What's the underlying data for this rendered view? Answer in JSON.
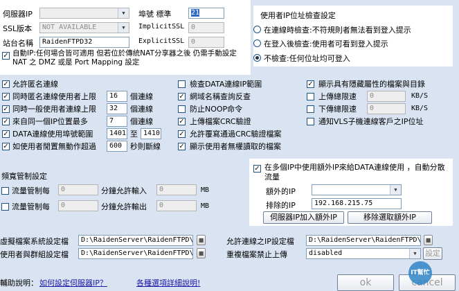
{
  "server": {
    "ip_label": "伺服器IP",
    "ip_value": "",
    "ssl_label": "SSL版本",
    "ssl_value": "NOT AVAILABLE",
    "site_label": "站台名稱",
    "site_value": "RaidenFTPD32",
    "port_label": "埠號 標準",
    "port_value": "21",
    "implicit_label": "ImplicitSSL",
    "implicit_value": "0",
    "explicit_label": "ExplicitSSL",
    "explicit_value": "0",
    "auto_ip_label": "自動IP:任何場合皆可適用 但若位於傳統NAT分享器之後 仍需手動設定 NAT 之 DMZ 或是 Port Mapping 設定",
    "auto_ip_checked": true
  },
  "ip_check": {
    "title": "使用者IP位址檢查設定",
    "options": [
      {
        "label": "在連線時檢查:不符規則者無法看到登入提示",
        "selected": false
      },
      {
        "label": "在登入後檢查:使用者可看到登入提示",
        "selected": false
      },
      {
        "label": "不檢查:任何位址均可登入",
        "selected": true
      }
    ]
  },
  "options_col1": {
    "anonymous": {
      "label": "允許匿名連線",
      "checked": true
    },
    "same_user": {
      "label": "同時匿名連線使用者上限",
      "value": "16",
      "unit": "個連線",
      "checked": true
    },
    "same_general": {
      "label": "同時一般使用者連線上限",
      "value": "32",
      "unit": "個連線",
      "checked": true
    },
    "same_ip": {
      "label": "來自同一個IP位置最多",
      "value": "7",
      "unit": "個連線",
      "checked": true
    },
    "data_port": {
      "label": "DATA連線使用埠號範圍",
      "from": "1401",
      "to_label": "至",
      "to": "1410",
      "checked": true
    },
    "idle": {
      "label": "如使用者閒置無動作超過",
      "value": "600",
      "unit": "秒則斷線",
      "checked": true
    }
  },
  "options_col2": [
    {
      "label": "檢查DATA連線IP範圍",
      "checked": false
    },
    {
      "label": "網域名稱查詢反查",
      "checked": true
    },
    {
      "label": "防止NOOP命令",
      "checked": false
    },
    {
      "label": "上傳檔案CRC驗證",
      "checked": true
    },
    {
      "label": "允許覆寫通過CRC驗證檔案",
      "checked": true
    },
    {
      "label": "顯示使用者無權讀取的檔案",
      "checked": true
    }
  ],
  "options_col3": {
    "hidden": {
      "label": "顯示具有隱藏屬性的檔案與目錄",
      "checked": true
    },
    "upload": {
      "label": "上傳總限速",
      "value": "0",
      "unit": "KB/S",
      "checked": false
    },
    "download": {
      "label": "下傳總限速",
      "value": "0",
      "unit": "KB/S",
      "checked": false
    },
    "vls": {
      "label": "通知VLS子機連線客戶之IP位址",
      "checked": false
    }
  },
  "bandwidth": {
    "title": "頻寬管制設定",
    "rows": [
      {
        "label": "流量管制每",
        "value": "0",
        "mid": "分鐘允許輸入",
        "value2": "0",
        "unit": "MB",
        "checked": false
      },
      {
        "label": "流量管制每",
        "value": "0",
        "mid": "分鐘允許輸出",
        "value2": "0",
        "unit": "MB",
        "checked": false
      }
    ]
  },
  "multi_ip": {
    "label": "在多個IP中使用額外IP來給DATA連線使用 ，自動分散流量",
    "checked": true,
    "extra_label": "額外的IP",
    "extra_value": "",
    "exclude_label": "排除的IP",
    "exclude_value": "192.168.215.75",
    "add_button": "伺服器IP加入額外IP",
    "remove_button": "移除選取額外IP"
  },
  "files": {
    "vfs_label": "虛擬檔案系統設定檔",
    "vfs_value": "D:\\RaidenServer\\RaidenFTPD\\",
    "group_label": "使用者與群組設定檔",
    "group_value": "D:\\RaidenServer\\RaidenFTPD\\",
    "allow_ip_label": "允許連線之IP設定檔",
    "allow_ip_value": "D:\\RaidenServer\\RaidenFTPD\\",
    "no_upload_label": "重複檔案禁止上傳",
    "no_upload_value": "disabled",
    "set_button": "設定"
  },
  "footer": {
    "help_label": "輔助說明：",
    "help_link": "如何設定伺服器IP？",
    "detail_link": "各種選項詳細說明!",
    "ok_button": "ok",
    "cancel_button": "cancel"
  },
  "watermark": "IT幫忙"
}
